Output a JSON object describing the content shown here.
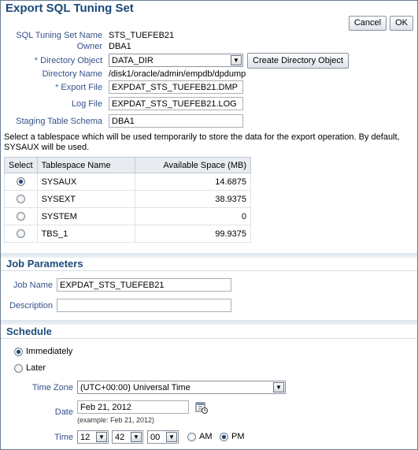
{
  "page": {
    "title": "Export SQL Tuning Set"
  },
  "buttons": {
    "cancel": "Cancel",
    "ok": "OK",
    "create_directory": "Create Directory Object"
  },
  "form": {
    "sts_name_label": "SQL Tuning Set Name",
    "sts_name_value": "STS_TUEFEB21",
    "owner_label": "Owner",
    "owner_value": "DBA1",
    "required_marker": "*",
    "directory_object_label": "Directory Object",
    "directory_object_value": "DATA_DIR",
    "directory_name_label": "Directory Name",
    "directory_name_value": "/disk1/oracle/admin/empdb/dpdump",
    "export_file_label": "Export File",
    "export_file_value": "EXPDAT_STS_TUEFEB21.DMP",
    "log_file_label": "Log File",
    "log_file_value": "EXPDAT_STS_TUEFEB21.LOG",
    "staging_schema_label": "Staging Table Schema",
    "staging_schema_value": "DBA1"
  },
  "tablespace": {
    "help_text": "Select a tablespace which will be used temporarily to store the data for the export operation. By default, SYSAUX will be used.",
    "columns": [
      "Select",
      "Tablespace Name",
      "Available Space (MB)"
    ],
    "rows": [
      {
        "name": "SYSAUX",
        "space": "14.6875",
        "selected": true
      },
      {
        "name": "SYSEXT",
        "space": "38.9375",
        "selected": false
      },
      {
        "name": "SYSTEM",
        "space": "0",
        "selected": false
      },
      {
        "name": "TBS_1",
        "space": "99.9375",
        "selected": false
      }
    ]
  },
  "job": {
    "section_title": "Job Parameters",
    "job_name_label": "Job Name",
    "job_name_value": "EXPDAT_STS_TUEFEB21",
    "description_label": "Description",
    "description_value": ""
  },
  "schedule": {
    "section_title": "Schedule",
    "immediately_label": "Immediately",
    "later_label": "Later",
    "immediately_selected": true,
    "timezone_label": "Time Zone",
    "timezone_value": "(UTC+00:00) Universal Time",
    "date_label": "Date",
    "date_value": "Feb 21, 2012",
    "date_example": "(example: Feb 21, 2012)",
    "time_label": "Time",
    "hour": "12",
    "minute": "42",
    "second": "00",
    "am_label": "AM",
    "pm_label": "PM",
    "pm_selected": true
  },
  "icons": {
    "dropdown": "chevron-down-icon",
    "calendar": "calendar-icon"
  },
  "colors": {
    "title": "#1c4a7a",
    "label": "#35528a",
    "section_bar": "#dde4ec"
  }
}
